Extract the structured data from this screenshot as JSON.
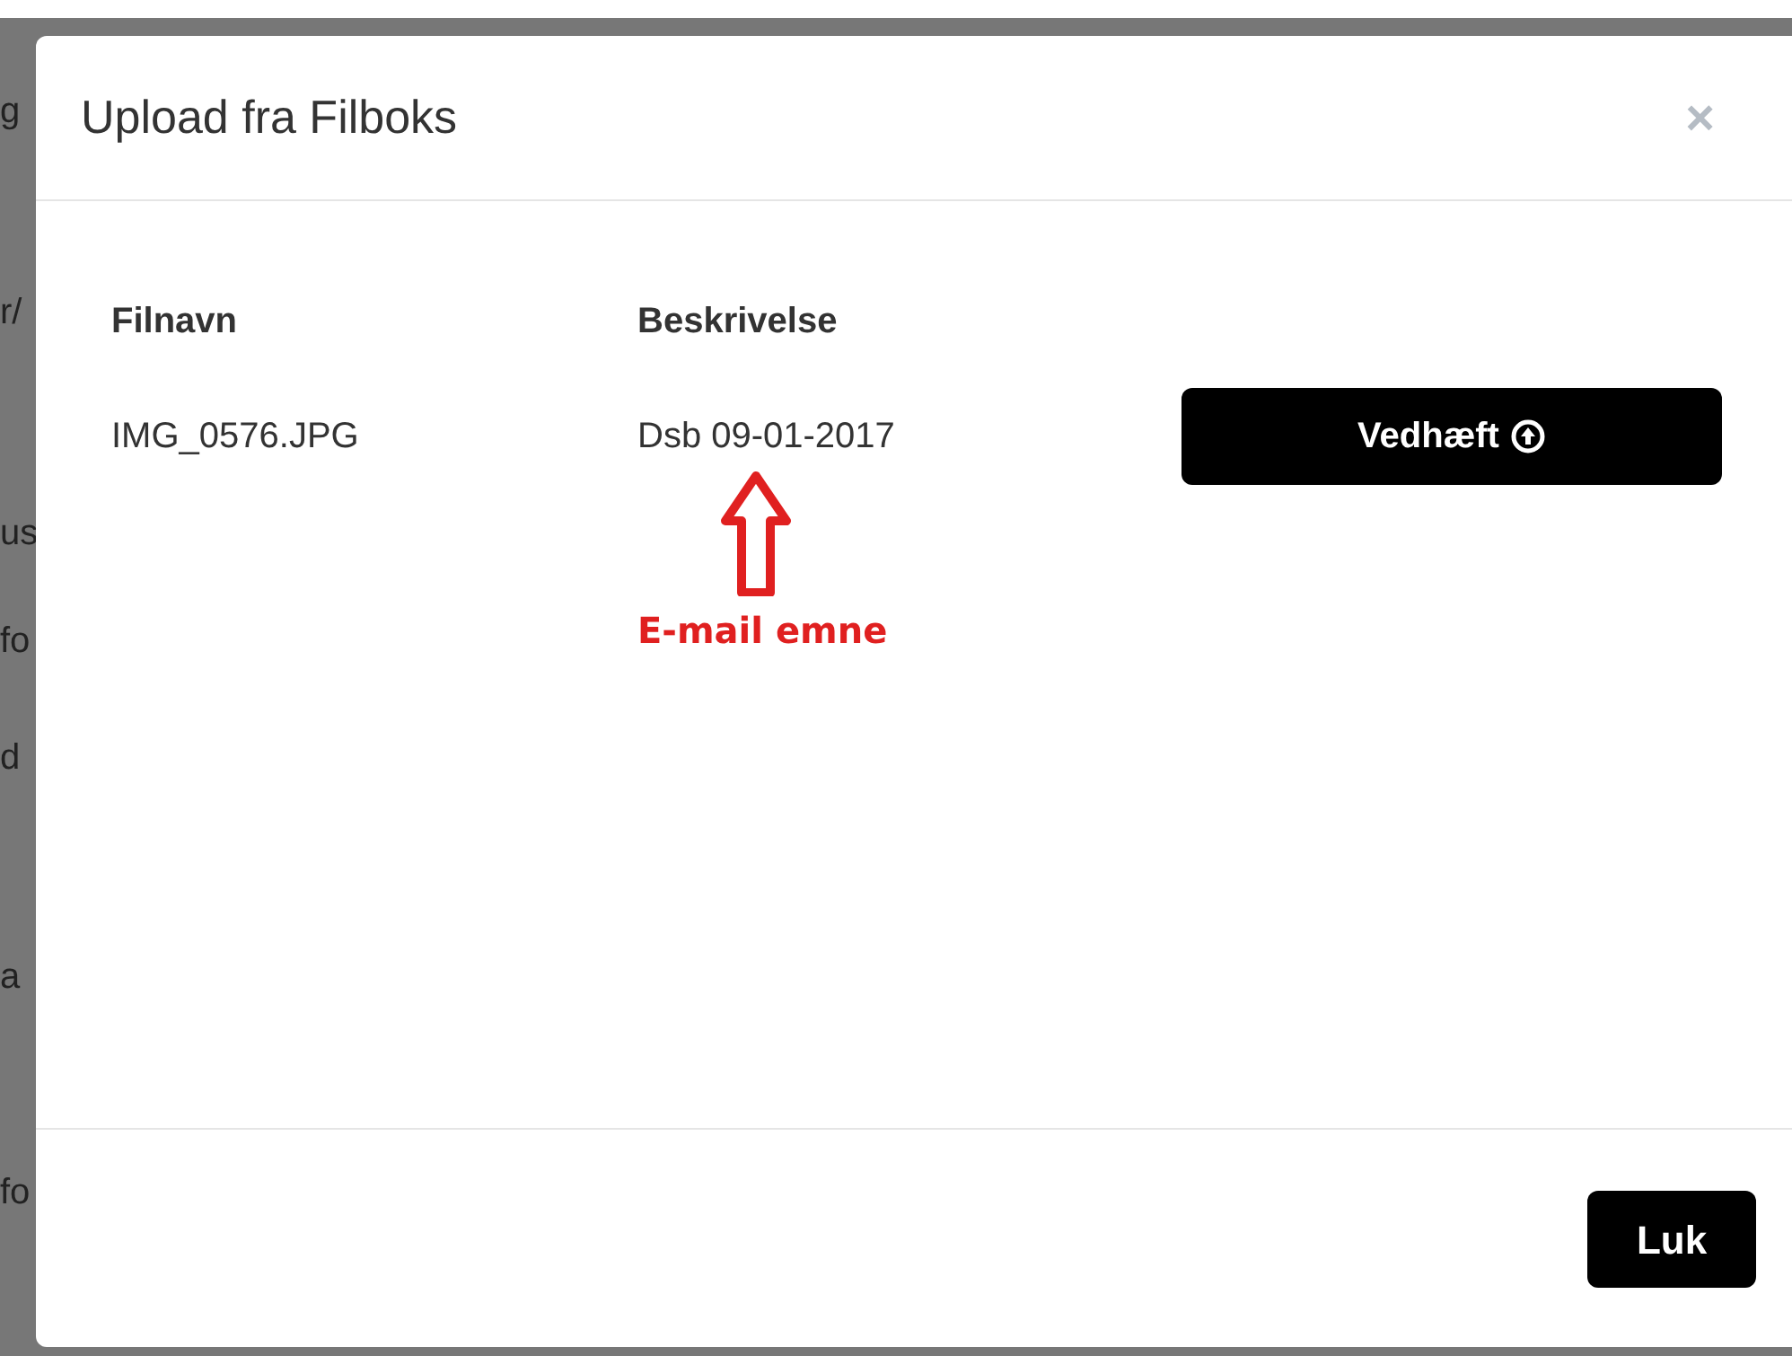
{
  "background_fragments": [
    "g",
    "r/",
    "us",
    "fo",
    "d",
    "a",
    "fo"
  ],
  "dialog": {
    "title": "Upload fra Filboks",
    "close": "×",
    "columns": [
      "Filnavn",
      "Beskrivelse"
    ],
    "rows": [
      {
        "filename": "IMG_0576.JPG",
        "description": "Dsb 09-01-2017",
        "button": "Vedhæft"
      }
    ],
    "annotation": {
      "label": "E-mail emne"
    },
    "footer_button": "Luk"
  }
}
